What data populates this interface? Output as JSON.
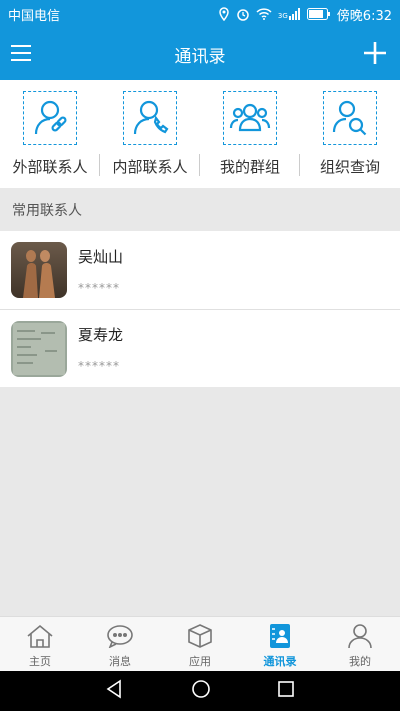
{
  "status": {
    "carrier": "中国电信",
    "time": "傍晚6:32",
    "signal_type": "3G"
  },
  "header": {
    "title": "通讯录",
    "menu_icon": "menu-icon",
    "add_icon": "plus-icon"
  },
  "quick_actions": [
    {
      "label": "外部联系人",
      "icon": "external-contact-icon"
    },
    {
      "label": "内部联系人",
      "icon": "internal-contact-icon"
    },
    {
      "label": "我的群组",
      "icon": "group-icon"
    },
    {
      "label": "组织查询",
      "icon": "org-search-icon"
    }
  ],
  "section": {
    "title": "常用联系人"
  },
  "contacts": [
    {
      "name": "吴灿山",
      "phone": "******"
    },
    {
      "name": "夏寿龙",
      "phone": "******"
    }
  ],
  "tabs": [
    {
      "label": "主页",
      "icon": "home-icon",
      "active": false
    },
    {
      "label": "消息",
      "icon": "message-icon",
      "active": false
    },
    {
      "label": "应用",
      "icon": "cube-icon",
      "active": false
    },
    {
      "label": "通讯录",
      "icon": "contacts-icon",
      "active": true
    },
    {
      "label": "我的",
      "icon": "user-icon",
      "active": false
    }
  ],
  "colors": {
    "primary": "#1296db",
    "background": "#e8e8e8"
  }
}
